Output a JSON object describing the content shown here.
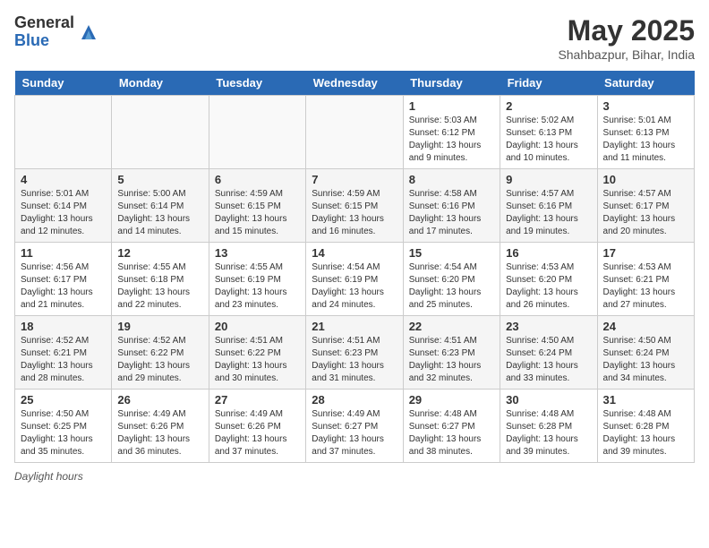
{
  "header": {
    "logo_general": "General",
    "logo_blue": "Blue",
    "month_year": "May 2025",
    "location": "Shahbazpur, Bihar, India"
  },
  "days_of_week": [
    "Sunday",
    "Monday",
    "Tuesday",
    "Wednesday",
    "Thursday",
    "Friday",
    "Saturday"
  ],
  "weeks": [
    [
      {
        "day": "",
        "info": ""
      },
      {
        "day": "",
        "info": ""
      },
      {
        "day": "",
        "info": ""
      },
      {
        "day": "",
        "info": ""
      },
      {
        "day": "1",
        "info": "Sunrise: 5:03 AM\nSunset: 6:12 PM\nDaylight: 13 hours\nand 9 minutes."
      },
      {
        "day": "2",
        "info": "Sunrise: 5:02 AM\nSunset: 6:13 PM\nDaylight: 13 hours\nand 10 minutes."
      },
      {
        "day": "3",
        "info": "Sunrise: 5:01 AM\nSunset: 6:13 PM\nDaylight: 13 hours\nand 11 minutes."
      }
    ],
    [
      {
        "day": "4",
        "info": "Sunrise: 5:01 AM\nSunset: 6:14 PM\nDaylight: 13 hours\nand 12 minutes."
      },
      {
        "day": "5",
        "info": "Sunrise: 5:00 AM\nSunset: 6:14 PM\nDaylight: 13 hours\nand 14 minutes."
      },
      {
        "day": "6",
        "info": "Sunrise: 4:59 AM\nSunset: 6:15 PM\nDaylight: 13 hours\nand 15 minutes."
      },
      {
        "day": "7",
        "info": "Sunrise: 4:59 AM\nSunset: 6:15 PM\nDaylight: 13 hours\nand 16 minutes."
      },
      {
        "day": "8",
        "info": "Sunrise: 4:58 AM\nSunset: 6:16 PM\nDaylight: 13 hours\nand 17 minutes."
      },
      {
        "day": "9",
        "info": "Sunrise: 4:57 AM\nSunset: 6:16 PM\nDaylight: 13 hours\nand 19 minutes."
      },
      {
        "day": "10",
        "info": "Sunrise: 4:57 AM\nSunset: 6:17 PM\nDaylight: 13 hours\nand 20 minutes."
      }
    ],
    [
      {
        "day": "11",
        "info": "Sunrise: 4:56 AM\nSunset: 6:17 PM\nDaylight: 13 hours\nand 21 minutes."
      },
      {
        "day": "12",
        "info": "Sunrise: 4:55 AM\nSunset: 6:18 PM\nDaylight: 13 hours\nand 22 minutes."
      },
      {
        "day": "13",
        "info": "Sunrise: 4:55 AM\nSunset: 6:19 PM\nDaylight: 13 hours\nand 23 minutes."
      },
      {
        "day": "14",
        "info": "Sunrise: 4:54 AM\nSunset: 6:19 PM\nDaylight: 13 hours\nand 24 minutes."
      },
      {
        "day": "15",
        "info": "Sunrise: 4:54 AM\nSunset: 6:20 PM\nDaylight: 13 hours\nand 25 minutes."
      },
      {
        "day": "16",
        "info": "Sunrise: 4:53 AM\nSunset: 6:20 PM\nDaylight: 13 hours\nand 26 minutes."
      },
      {
        "day": "17",
        "info": "Sunrise: 4:53 AM\nSunset: 6:21 PM\nDaylight: 13 hours\nand 27 minutes."
      }
    ],
    [
      {
        "day": "18",
        "info": "Sunrise: 4:52 AM\nSunset: 6:21 PM\nDaylight: 13 hours\nand 28 minutes."
      },
      {
        "day": "19",
        "info": "Sunrise: 4:52 AM\nSunset: 6:22 PM\nDaylight: 13 hours\nand 29 minutes."
      },
      {
        "day": "20",
        "info": "Sunrise: 4:51 AM\nSunset: 6:22 PM\nDaylight: 13 hours\nand 30 minutes."
      },
      {
        "day": "21",
        "info": "Sunrise: 4:51 AM\nSunset: 6:23 PM\nDaylight: 13 hours\nand 31 minutes."
      },
      {
        "day": "22",
        "info": "Sunrise: 4:51 AM\nSunset: 6:23 PM\nDaylight: 13 hours\nand 32 minutes."
      },
      {
        "day": "23",
        "info": "Sunrise: 4:50 AM\nSunset: 6:24 PM\nDaylight: 13 hours\nand 33 minutes."
      },
      {
        "day": "24",
        "info": "Sunrise: 4:50 AM\nSunset: 6:24 PM\nDaylight: 13 hours\nand 34 minutes."
      }
    ],
    [
      {
        "day": "25",
        "info": "Sunrise: 4:50 AM\nSunset: 6:25 PM\nDaylight: 13 hours\nand 35 minutes."
      },
      {
        "day": "26",
        "info": "Sunrise: 4:49 AM\nSunset: 6:26 PM\nDaylight: 13 hours\nand 36 minutes."
      },
      {
        "day": "27",
        "info": "Sunrise: 4:49 AM\nSunset: 6:26 PM\nDaylight: 13 hours\nand 37 minutes."
      },
      {
        "day": "28",
        "info": "Sunrise: 4:49 AM\nSunset: 6:27 PM\nDaylight: 13 hours\nand 37 minutes."
      },
      {
        "day": "29",
        "info": "Sunrise: 4:48 AM\nSunset: 6:27 PM\nDaylight: 13 hours\nand 38 minutes."
      },
      {
        "day": "30",
        "info": "Sunrise: 4:48 AM\nSunset: 6:28 PM\nDaylight: 13 hours\nand 39 minutes."
      },
      {
        "day": "31",
        "info": "Sunrise: 4:48 AM\nSunset: 6:28 PM\nDaylight: 13 hours\nand 39 minutes."
      }
    ]
  ],
  "footer": {
    "daylight_hours_label": "Daylight hours"
  }
}
